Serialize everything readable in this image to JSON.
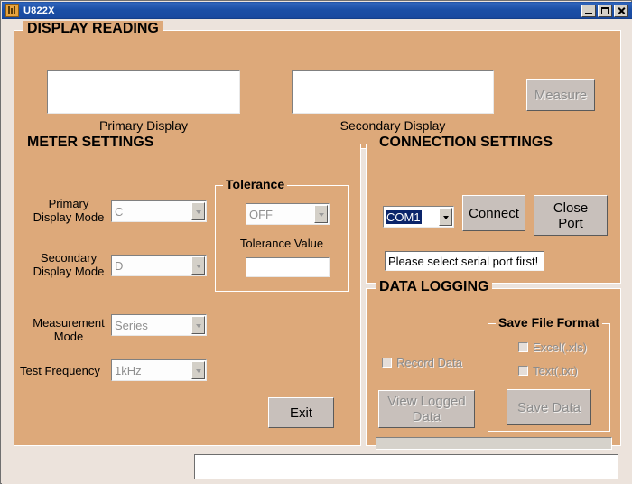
{
  "window": {
    "title": "U822X",
    "icon": "app-icon",
    "controls": {
      "minimize": "Minimize",
      "maximize": "Maximize",
      "close": "Close"
    }
  },
  "display_reading": {
    "legend": "DISPLAY READING",
    "primary_value": "",
    "primary_label": "Primary Display",
    "secondary_value": "",
    "secondary_label": "Secondary Display",
    "measure_button": "Measure"
  },
  "meter_settings": {
    "legend": "METER SETTINGS",
    "primary_mode_label": "Primary\nDisplay Mode",
    "primary_mode_value": "C",
    "secondary_mode_label": "Secondary\nDisplay Mode",
    "secondary_mode_value": "D",
    "measurement_mode_label": "Measurement\nMode",
    "measurement_mode_value": "Series",
    "test_frequency_label": "Test Frequency",
    "test_frequency_value": "1kHz",
    "exit_button": "Exit",
    "tolerance": {
      "legend": "Tolerance",
      "mode_value": "OFF",
      "value_label": "Tolerance Value",
      "value": ""
    }
  },
  "connection_settings": {
    "legend": "CONNECTION SETTINGS",
    "port_value": "COM1",
    "connect_button": "Connect",
    "close_port_button": "Close\nPort",
    "status_message": "Please select serial port first!"
  },
  "data_logging": {
    "legend": "DATA LOGGING",
    "record_data_label": "Record Data",
    "view_logged_data_button": "View Logged\nData",
    "save_file_format": {
      "legend": "Save File Format",
      "excel_label": "Excel(.xls)",
      "text_label": "Text(.txt)",
      "save_button": "Save Data"
    }
  },
  "status_bar": {
    "value": ""
  },
  "colors": {
    "panel": "#dda97a",
    "window_bg": "#ece3dc",
    "titlebar": "#1b4fa6",
    "selection": "#0a246a",
    "button_face": "#c8c0bb"
  }
}
